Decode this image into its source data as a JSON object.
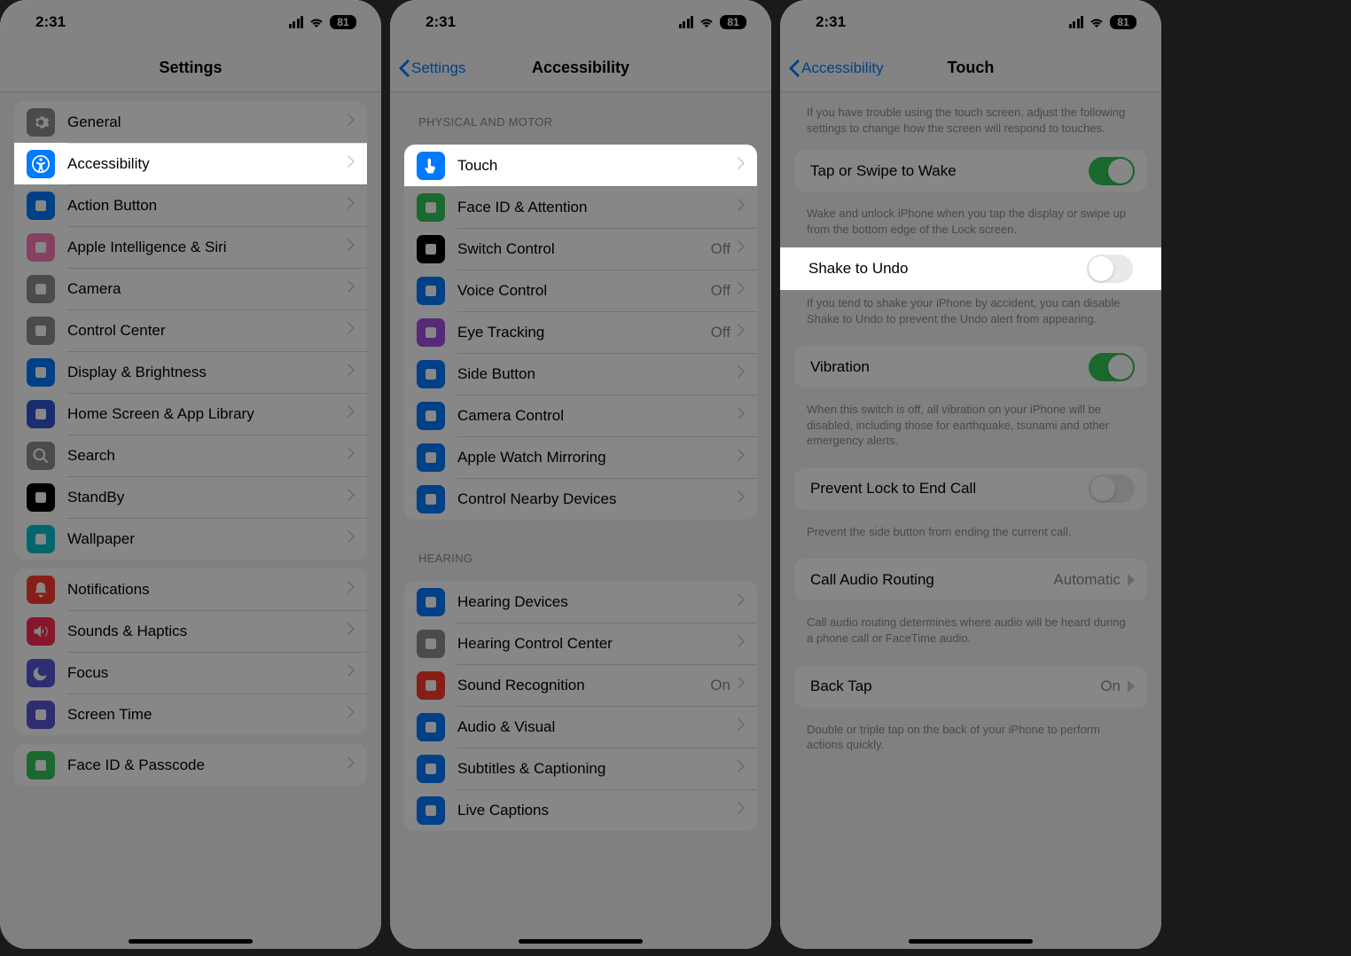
{
  "status": {
    "time": "2:31",
    "battery": "81"
  },
  "screen1": {
    "title": "Settings",
    "groupA": [
      {
        "label": "General",
        "icon": "gear",
        "bg": "#8e8e93"
      },
      {
        "label": "Accessibility",
        "icon": "accessibility",
        "bg": "#007aff",
        "highlight": true
      },
      {
        "label": "Action Button",
        "icon": "action",
        "bg": "#007aff"
      },
      {
        "label": "Apple Intelligence & Siri",
        "icon": "siri",
        "bg": "#ff7ab6"
      },
      {
        "label": "Camera",
        "icon": "camera",
        "bg": "#8e8e93"
      },
      {
        "label": "Control Center",
        "icon": "control",
        "bg": "#8e8e93"
      },
      {
        "label": "Display & Brightness",
        "icon": "display",
        "bg": "#007aff"
      },
      {
        "label": "Home Screen & App Library",
        "icon": "home",
        "bg": "#3355d6"
      },
      {
        "label": "Search",
        "icon": "search",
        "bg": "#8e8e93"
      },
      {
        "label": "StandBy",
        "icon": "standby",
        "bg": "#000"
      },
      {
        "label": "Wallpaper",
        "icon": "wallpaper",
        "bg": "#00c2d1"
      }
    ],
    "groupB": [
      {
        "label": "Notifications",
        "icon": "bell",
        "bg": "#ff3b30"
      },
      {
        "label": "Sounds & Haptics",
        "icon": "speaker",
        "bg": "#ff2d55"
      },
      {
        "label": "Focus",
        "icon": "moon",
        "bg": "#5856d6"
      },
      {
        "label": "Screen Time",
        "icon": "hourglass",
        "bg": "#5856d6"
      }
    ],
    "groupC": [
      {
        "label": "Face ID & Passcode",
        "icon": "faceid",
        "bg": "#34c759"
      }
    ]
  },
  "screen2": {
    "back": "Settings",
    "title": "Accessibility",
    "sectionPhysical": "PHYSICAL AND MOTOR",
    "physical": [
      {
        "label": "Touch",
        "icon": "touch",
        "bg": "#007aff",
        "highlight": true
      },
      {
        "label": "Face ID & Attention",
        "icon": "faceid",
        "bg": "#34c759"
      },
      {
        "label": "Switch Control",
        "icon": "switch",
        "bg": "#000",
        "value": "Off"
      },
      {
        "label": "Voice Control",
        "icon": "voice",
        "bg": "#007aff",
        "value": "Off"
      },
      {
        "label": "Eye Tracking",
        "icon": "eye",
        "bg": "#a050e0",
        "value": "Off"
      },
      {
        "label": "Side Button",
        "icon": "side",
        "bg": "#007aff"
      },
      {
        "label": "Camera Control",
        "icon": "camcontrol",
        "bg": "#007aff"
      },
      {
        "label": "Apple Watch Mirroring",
        "icon": "watch",
        "bg": "#007aff"
      },
      {
        "label": "Control Nearby Devices",
        "icon": "nearby",
        "bg": "#007aff"
      }
    ],
    "sectionHearing": "HEARING",
    "hearing": [
      {
        "label": "Hearing Devices",
        "icon": "ear",
        "bg": "#007aff"
      },
      {
        "label": "Hearing Control Center",
        "icon": "hcc",
        "bg": "#8e8e93"
      },
      {
        "label": "Sound Recognition",
        "icon": "sound",
        "bg": "#ff3b30",
        "value": "On"
      },
      {
        "label": "Audio & Visual",
        "icon": "audio",
        "bg": "#007aff"
      },
      {
        "label": "Subtitles & Captioning",
        "icon": "captions",
        "bg": "#007aff"
      },
      {
        "label": "Live Captions",
        "icon": "live",
        "bg": "#007aff"
      }
    ]
  },
  "screen3": {
    "back": "Accessibility",
    "title": "Touch",
    "intro": "If you have trouble using the touch screen, adjust the following settings to change how the screen will respond to touches.",
    "tapWake": {
      "label": "Tap or Swipe to Wake",
      "on": true,
      "footer": "Wake and unlock iPhone when you tap the display or swipe up from the bottom edge of the Lock screen."
    },
    "shake": {
      "label": "Shake to Undo",
      "on": false,
      "footer": "If you tend to shake your iPhone by accident, you can disable Shake to Undo to prevent the Undo alert from appearing.",
      "highlight": true
    },
    "vibration": {
      "label": "Vibration",
      "on": true,
      "footer": "When this switch is off, all vibration on your iPhone will be disabled, including those for earthquake, tsunami and other emergency alerts."
    },
    "prevent": {
      "label": "Prevent Lock to End Call",
      "on": false,
      "footer": "Prevent the side button from ending the current call."
    },
    "routing": {
      "label": "Call Audio Routing",
      "value": "Automatic",
      "footer": "Call audio routing determines where audio will be heard during a phone call or FaceTime audio."
    },
    "backtap": {
      "label": "Back Tap",
      "value": "On",
      "footer": "Double or triple tap on the back of your iPhone to perform actions quickly."
    }
  }
}
